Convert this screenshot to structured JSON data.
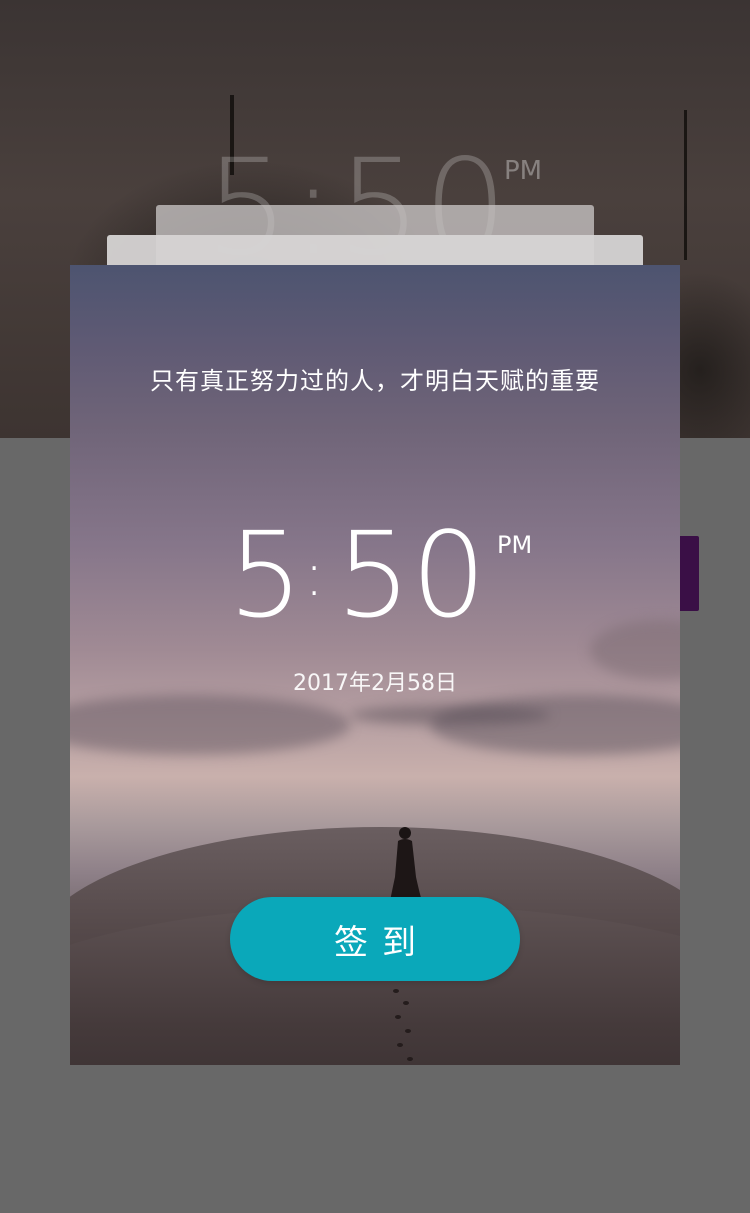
{
  "background": {
    "clock": {
      "time": "5:50",
      "ampm": "PM"
    }
  },
  "card": {
    "quote": "只有真正努力过的人，才明白天赋的重要",
    "time": {
      "hour": "5",
      "colon": ":",
      "minutes": "50",
      "ampm": "PM"
    },
    "date": "2017年2月58日",
    "checkin_button": "签到"
  },
  "colors": {
    "accent": "#0aa8ba",
    "overlay": "#686868",
    "purple_tab": "#3a0f46"
  }
}
